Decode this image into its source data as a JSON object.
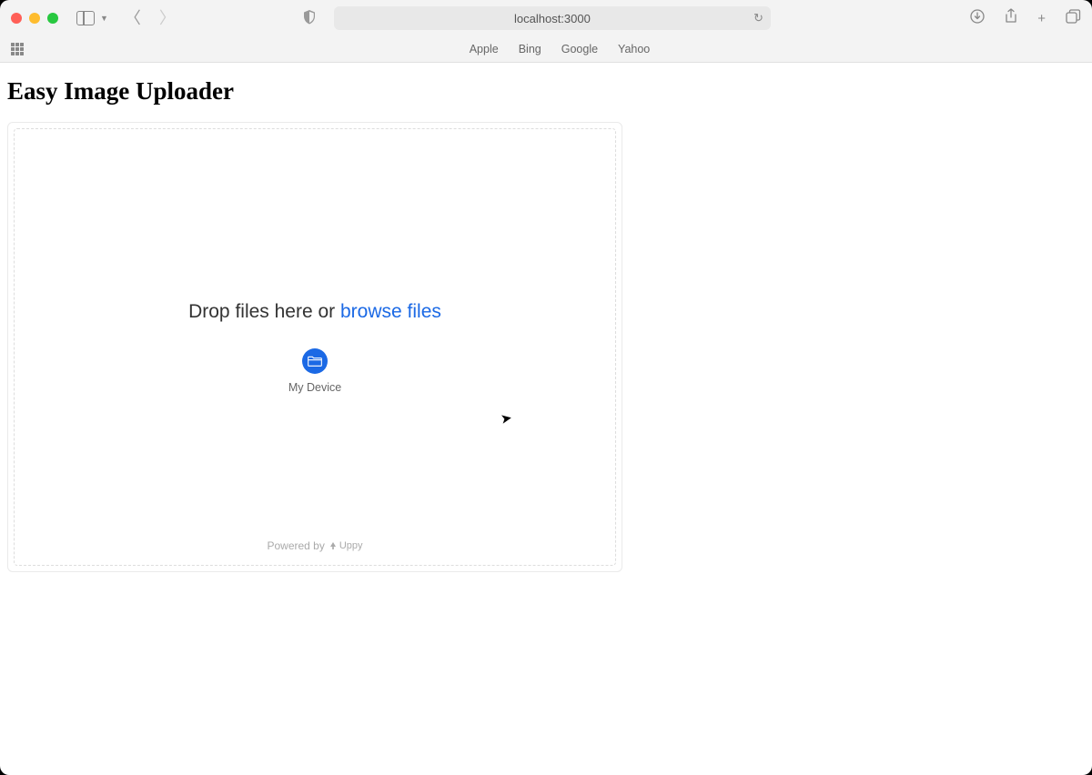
{
  "browser": {
    "url": "localhost:3000",
    "favorites": [
      "Apple",
      "Bing",
      "Google",
      "Yahoo"
    ]
  },
  "page": {
    "title": "Easy Image Uploader"
  },
  "uploader": {
    "drop_text": "Drop files here or ",
    "browse_text": "browse files",
    "device_label": "My Device",
    "powered_by_prefix": "Powered by",
    "powered_by_name": "Uppy"
  },
  "colors": {
    "accent": "#1b69e5"
  }
}
